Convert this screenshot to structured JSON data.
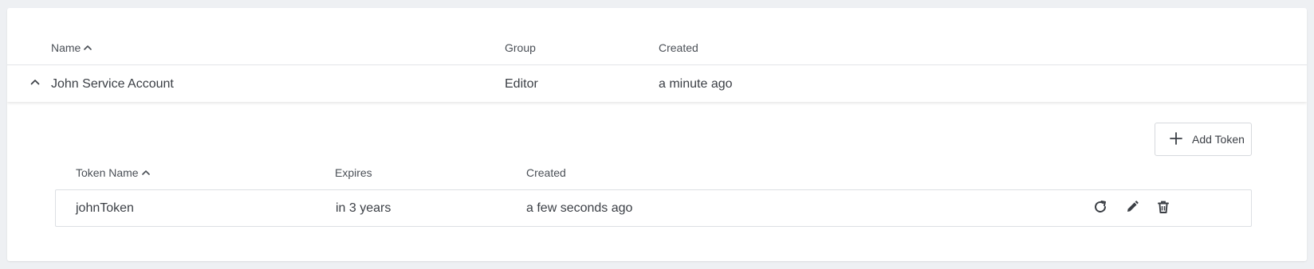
{
  "accounts_table": {
    "columns": {
      "name": "Name",
      "group": "Group",
      "created": "Created"
    },
    "rows": [
      {
        "name": "John Service Account",
        "group": "Editor",
        "created": "a minute ago",
        "expanded": true
      }
    ]
  },
  "tokens_panel": {
    "add_token_label": "Add Token",
    "columns": {
      "token_name": "Token Name",
      "expires": "Expires",
      "created": "Created"
    },
    "rows": [
      {
        "token_name": "johnToken",
        "expires": "in 3 years",
        "created": "a few seconds ago"
      }
    ],
    "row_actions": [
      "refresh-icon",
      "edit-icon",
      "delete-icon"
    ]
  },
  "icons": {
    "sort": "chevron-up-icon",
    "collapse": "chevron-up-icon",
    "add": "plus-icon"
  },
  "colors": {
    "background": "#eef0f3",
    "card": "#ffffff",
    "text": "#3b3f45",
    "border": "#dcdfe3"
  }
}
